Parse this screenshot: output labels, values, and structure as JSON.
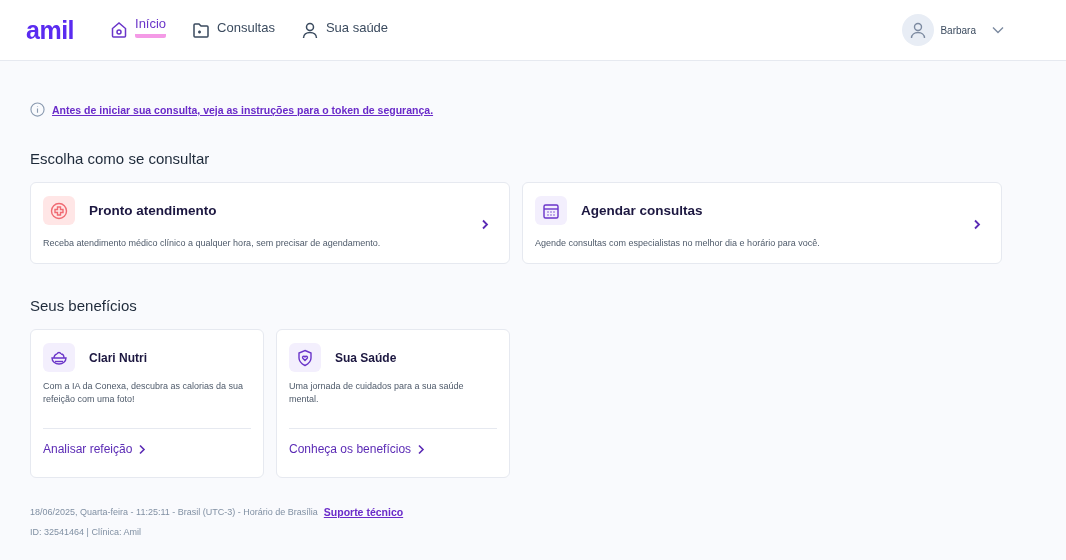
{
  "header": {
    "logo": "amil",
    "nav": [
      {
        "label": "Início",
        "kind": "home",
        "selected": true
      },
      {
        "label": "Consultas",
        "kind": "folder",
        "selected": false
      },
      {
        "label": "Sua saúde",
        "kind": "person",
        "selected": false
      }
    ],
    "user": {
      "name": "Barbara"
    }
  },
  "notice": {
    "link": "Antes de iniciar sua consulta, veja as instruções para o token de segurança."
  },
  "consult": {
    "heading": "Escolha como se consultar",
    "cards": [
      {
        "title": "Pronto atendimento",
        "kind": "urgent",
        "description": "Receba atendimento médico clínico a qualquer hora, sem precisar de agendamento."
      },
      {
        "title": "Agendar consultas",
        "kind": "calendar",
        "description": "Agende consultas com especialistas no melhor dia e horário para você."
      }
    ]
  },
  "benefits": {
    "heading": "Seus benefícios",
    "cards": [
      {
        "title": "Clari Nutri",
        "kind": "bowl",
        "description": "Com a IA da Conexa, descubra as calorias da sua refeição com uma foto!",
        "action": "Analisar refeição"
      },
      {
        "title": "Sua Saúde",
        "kind": "shield",
        "description": "Uma jornada de cuidados para a sua saúde mental.",
        "action": "Conheça os benefícios"
      }
    ]
  },
  "footer": {
    "timestamp": "18/06/2025, Quarta-feira - 11:25:11 - Brasil (UTC-3) - Horário de Brasília",
    "support_link": "Suporte técnico",
    "id_line": "ID: 32541464 | Clínica: Amil"
  }
}
